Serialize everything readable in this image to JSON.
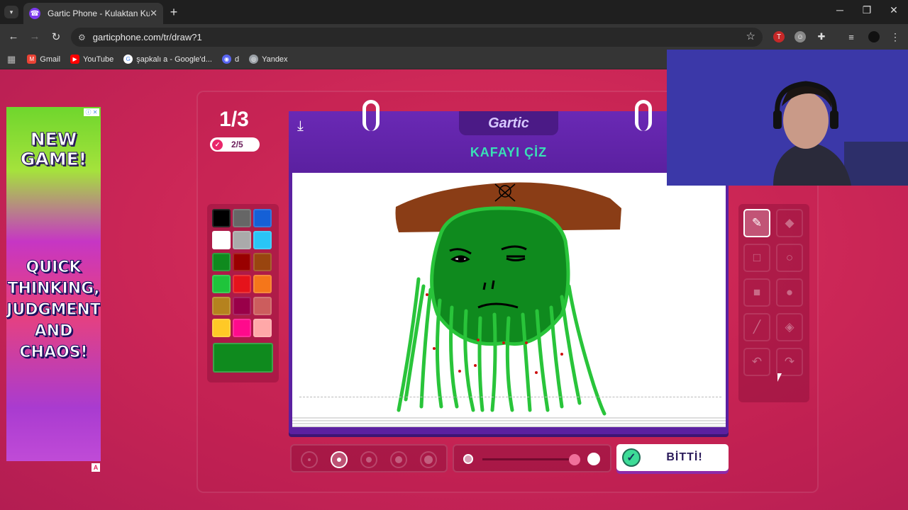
{
  "browser": {
    "tab_title": "Gartic Phone - Kulaktan Kulağa",
    "url": "garticphone.com/tr/draw?1",
    "bookmarks": [
      {
        "label": "Gmail",
        "icon": "gmail-icon",
        "color": "#ea4335"
      },
      {
        "label": "YouTube",
        "icon": "youtube-icon",
        "color": "#ff0000"
      },
      {
        "label": "şapkalı a - Google'd...",
        "icon": "google-icon",
        "color": "#4285f4"
      },
      {
        "label": "d",
        "icon": "discord-icon",
        "color": "#5865f2"
      },
      {
        "label": "Yandex",
        "icon": "globe-icon",
        "color": "#9aa0a6"
      }
    ]
  },
  "ad": {
    "headline": "NEW GAME!",
    "tagline": "QUICK THINKING, JUDGMENT AND CHAOS!",
    "colors": {
      "top": "#6fd62d",
      "middle": "#c636c4",
      "bottom": "#a93bd0"
    }
  },
  "game": {
    "round": "1/3",
    "done_count": "2/5",
    "logo": "Gartic",
    "prompt": "KAFAYI ÇİZ",
    "done_button": "BİTTİ!",
    "palette": [
      "#000000",
      "#666666",
      "#1560d6",
      "#ffffff",
      "#aaaaaa",
      "#29c5f6",
      "#0f8a1e",
      "#990000",
      "#99450f",
      "#1fc43b",
      "#e5131b",
      "#f5761a",
      "#b5821e",
      "#990049",
      "#cc5d5d",
      "#ffc926",
      "#ff0a8c",
      "#ffa8a8"
    ],
    "selected_color": "#0f8a1e",
    "active_tool": "pencil",
    "brush_size_index": 1,
    "opacity": 1.0,
    "tools": [
      {
        "name": "pencil-icon",
        "glyph": "✎"
      },
      {
        "name": "eraser-icon",
        "glyph": "◆"
      },
      {
        "name": "rectangle-outline-icon",
        "glyph": "□"
      },
      {
        "name": "circle-outline-icon",
        "glyph": "○"
      },
      {
        "name": "rectangle-filled-icon",
        "glyph": "■"
      },
      {
        "name": "circle-filled-icon",
        "glyph": "●"
      },
      {
        "name": "line-icon",
        "glyph": "╱"
      },
      {
        "name": "fill-bucket-icon",
        "glyph": "◈"
      },
      {
        "name": "undo-icon",
        "glyph": "↶"
      },
      {
        "name": "redo-icon",
        "glyph": "↷"
      }
    ]
  },
  "colors": {
    "page_bg": "#c92556",
    "book": "#5b20a0",
    "prompt": "#39e0b6",
    "pirate_green": "#0f8a1e",
    "beard_green": "#29c43a",
    "hat_brown": "#8a3d16"
  }
}
